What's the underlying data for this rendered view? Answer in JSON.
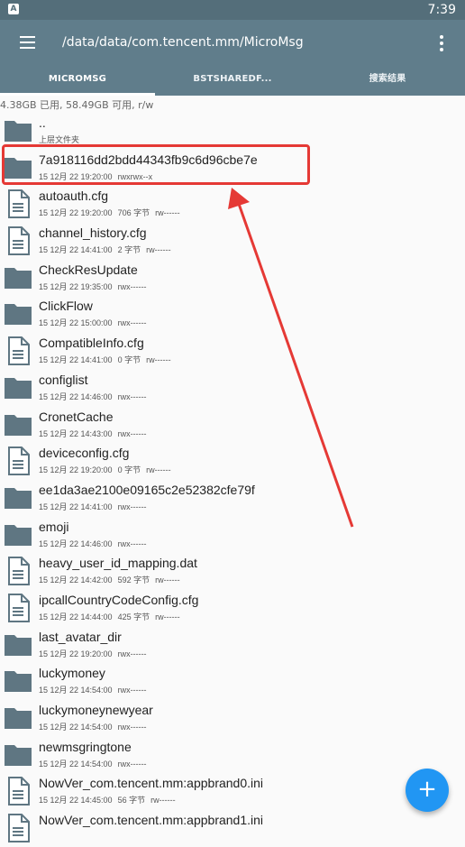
{
  "status_bar": {
    "notification_glyph": "A",
    "time": "7:39"
  },
  "toolbar": {
    "menu_icon": "hamburger-menu-icon",
    "path": "/data/data/com.tencent.mm/MicroMsg",
    "overflow_icon": "more-vert-icon"
  },
  "tabs": [
    {
      "label": "MICROMSG",
      "active": true
    },
    {
      "label": "BSTSHAREDF...",
      "active": false
    },
    {
      "label": "搜索结果",
      "active": false
    }
  ],
  "storage_info": "4.38GB 已用, 58.49GB 可用, r/w",
  "files": [
    {
      "type": "folder",
      "name": "..",
      "date": "上层文件夹",
      "size": "",
      "perms": ""
    },
    {
      "type": "folder",
      "name": "7a918116dd2bdd44343fb9c6d96cbe7e",
      "date": "15 12月 22 19:20:00",
      "size": "",
      "perms": "rwxrwx--x"
    },
    {
      "type": "file",
      "name": "autoauth.cfg",
      "date": "15 12月 22 19:20:00",
      "size": "706 字节",
      "perms": "rw------"
    },
    {
      "type": "file",
      "name": "channel_history.cfg",
      "date": "15 12月 22 14:41:00",
      "size": "2 字节",
      "perms": "rw------"
    },
    {
      "type": "folder",
      "name": "CheckResUpdate",
      "date": "15 12月 22 19:35:00",
      "size": "",
      "perms": "rwx------"
    },
    {
      "type": "folder",
      "name": "ClickFlow",
      "date": "15 12月 22 15:00:00",
      "size": "",
      "perms": "rwx------"
    },
    {
      "type": "file",
      "name": "CompatibleInfo.cfg",
      "date": "15 12月 22 14:41:00",
      "size": "0 字节",
      "perms": "rw------"
    },
    {
      "type": "folder",
      "name": "configlist",
      "date": "15 12月 22 14:46:00",
      "size": "",
      "perms": "rwx------"
    },
    {
      "type": "folder",
      "name": "CronetCache",
      "date": "15 12月 22 14:43:00",
      "size": "",
      "perms": "rwx------"
    },
    {
      "type": "file",
      "name": "deviceconfig.cfg",
      "date": "15 12月 22 19:20:00",
      "size": "0 字节",
      "perms": "rw------"
    },
    {
      "type": "folder",
      "name": "ee1da3ae2100e09165c2e52382cfe79f",
      "date": "15 12月 22 14:41:00",
      "size": "",
      "perms": "rwx------"
    },
    {
      "type": "folder",
      "name": "emoji",
      "date": "15 12月 22 14:46:00",
      "size": "",
      "perms": "rwx------"
    },
    {
      "type": "file",
      "name": "heavy_user_id_mapping.dat",
      "date": "15 12月 22 14:42:00",
      "size": "592 字节",
      "perms": "rw------"
    },
    {
      "type": "file",
      "name": "ipcallCountryCodeConfig.cfg",
      "date": "15 12月 22 14:44:00",
      "size": "425 字节",
      "perms": "rw------"
    },
    {
      "type": "folder",
      "name": "last_avatar_dir",
      "date": "15 12月 22 19:20:00",
      "size": "",
      "perms": "rwx------"
    },
    {
      "type": "folder",
      "name": "luckymoney",
      "date": "15 12月 22 14:54:00",
      "size": "",
      "perms": "rwx------"
    },
    {
      "type": "folder",
      "name": "luckymoneynewyear",
      "date": "15 12月 22 14:54:00",
      "size": "",
      "perms": "rwx------"
    },
    {
      "type": "folder",
      "name": "newmsgringtone",
      "date": "15 12月 22 14:54:00",
      "size": "",
      "perms": "rwx------"
    },
    {
      "type": "file",
      "name": "NowVer_com.tencent.mm:appbrand0.ini",
      "date": "15 12月 22 14:45:00",
      "size": "56 字节",
      "perms": "rw------"
    },
    {
      "type": "file",
      "name": "NowVer_com.tencent.mm:appbrand1.ini",
      "date": "",
      "size": "",
      "perms": ""
    }
  ],
  "fab": {
    "label": "+",
    "icon": "add-icon"
  },
  "colors": {
    "appbar": "#607d8b",
    "statusbar": "#546e7a",
    "icon": "#5f7682",
    "fab": "#2196f3",
    "annotation": "#e53935"
  }
}
